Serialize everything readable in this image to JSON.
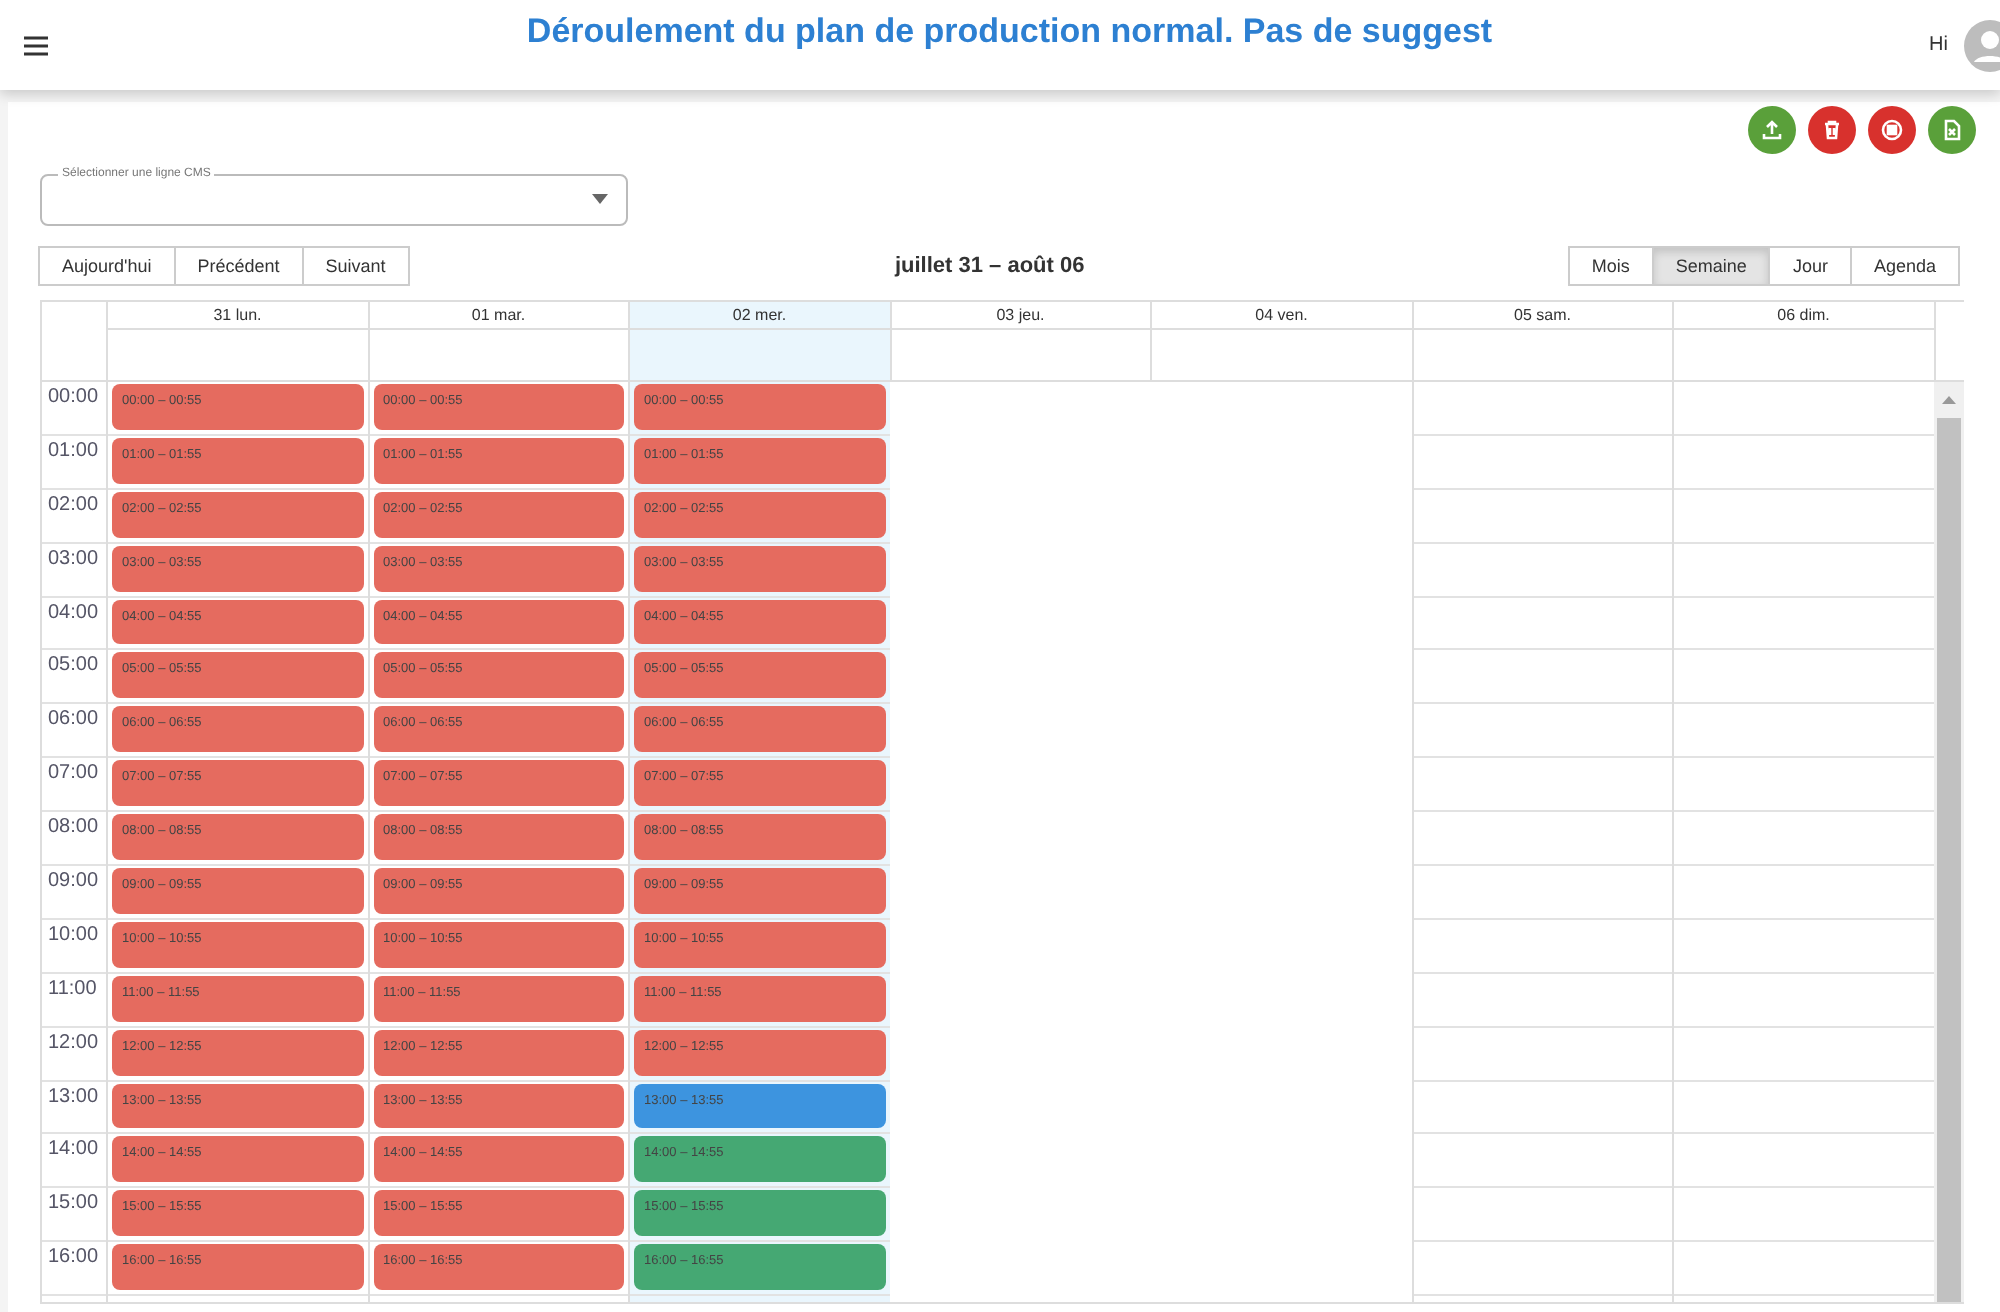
{
  "header": {
    "title": "Déroulement du plan de production normal. Pas de suggest",
    "greeting": "Hi"
  },
  "actions": [
    {
      "kind": "upload",
      "color": "#5aa03a"
    },
    {
      "kind": "delete",
      "color": "#d8312d"
    },
    {
      "kind": "stop",
      "color": "#d8312d"
    },
    {
      "kind": "excel",
      "color": "#5aa03a"
    }
  ],
  "line_select": {
    "label": "Sélectionner une ligne CMS"
  },
  "toolbar": {
    "nav": [
      "Aujourd'hui",
      "Précédent",
      "Suivant"
    ],
    "range": "juillet 31 – août 06",
    "views": [
      {
        "label": "Mois",
        "selected": false
      },
      {
        "label": "Semaine",
        "selected": true
      },
      {
        "label": "Jour",
        "selected": false
      },
      {
        "label": "Agenda",
        "selected": false
      }
    ]
  },
  "hours": [
    "00:00",
    "01:00",
    "02:00",
    "03:00",
    "04:00",
    "05:00",
    "06:00",
    "07:00",
    "08:00",
    "09:00",
    "10:00",
    "11:00",
    "12:00",
    "13:00",
    "14:00",
    "15:00",
    "16:00"
  ],
  "days": [
    {
      "label": "31 lun.",
      "today": false,
      "blank": false,
      "events": [
        {
          "time": "00:00 – 00:55",
          "color": "#e56b5f"
        },
        {
          "time": "01:00 – 01:55",
          "color": "#e56b5f"
        },
        {
          "time": "02:00 – 02:55",
          "color": "#e56b5f"
        },
        {
          "time": "03:00 – 03:55",
          "color": "#e56b5f"
        },
        {
          "time": "04:00 – 04:55",
          "color": "#e56b5f"
        },
        {
          "time": "05:00 – 05:55",
          "color": "#e56b5f"
        },
        {
          "time": "06:00 – 06:55",
          "color": "#e56b5f"
        },
        {
          "time": "07:00 – 07:55",
          "color": "#e56b5f"
        },
        {
          "time": "08:00 – 08:55",
          "color": "#e56b5f"
        },
        {
          "time": "09:00 – 09:55",
          "color": "#e56b5f"
        },
        {
          "time": "10:00 – 10:55",
          "color": "#e56b5f"
        },
        {
          "time": "11:00 – 11:55",
          "color": "#e56b5f"
        },
        {
          "time": "12:00 – 12:55",
          "color": "#e56b5f"
        },
        {
          "time": "13:00 – 13:55",
          "color": "#e56b5f"
        },
        {
          "time": "14:00 – 14:55",
          "color": "#e56b5f"
        },
        {
          "time": "15:00 – 15:55",
          "color": "#e56b5f"
        },
        {
          "time": "16:00 – 16:55",
          "color": "#e56b5f"
        }
      ]
    },
    {
      "label": "01 mar.",
      "today": false,
      "blank": false,
      "events": [
        {
          "time": "00:00 – 00:55",
          "color": "#e56b5f"
        },
        {
          "time": "01:00 – 01:55",
          "color": "#e56b5f"
        },
        {
          "time": "02:00 – 02:55",
          "color": "#e56b5f"
        },
        {
          "time": "03:00 – 03:55",
          "color": "#e56b5f"
        },
        {
          "time": "04:00 – 04:55",
          "color": "#e56b5f"
        },
        {
          "time": "05:00 – 05:55",
          "color": "#e56b5f"
        },
        {
          "time": "06:00 – 06:55",
          "color": "#e56b5f"
        },
        {
          "time": "07:00 – 07:55",
          "color": "#e56b5f"
        },
        {
          "time": "08:00 – 08:55",
          "color": "#e56b5f"
        },
        {
          "time": "09:00 – 09:55",
          "color": "#e56b5f"
        },
        {
          "time": "10:00 – 10:55",
          "color": "#e56b5f"
        },
        {
          "time": "11:00 – 11:55",
          "color": "#e56b5f"
        },
        {
          "time": "12:00 – 12:55",
          "color": "#e56b5f"
        },
        {
          "time": "13:00 – 13:55",
          "color": "#e56b5f"
        },
        {
          "time": "14:00 – 14:55",
          "color": "#e56b5f"
        },
        {
          "time": "15:00 – 15:55",
          "color": "#e56b5f"
        },
        {
          "time": "16:00 – 16:55",
          "color": "#e56b5f"
        }
      ]
    },
    {
      "label": "02 mer.",
      "today": true,
      "blank": false,
      "events": [
        {
          "time": "00:00 – 00:55",
          "color": "#e56b5f"
        },
        {
          "time": "01:00 – 01:55",
          "color": "#e56b5f"
        },
        {
          "time": "02:00 – 02:55",
          "color": "#e56b5f"
        },
        {
          "time": "03:00 – 03:55",
          "color": "#e56b5f"
        },
        {
          "time": "04:00 – 04:55",
          "color": "#e56b5f"
        },
        {
          "time": "05:00 – 05:55",
          "color": "#e56b5f"
        },
        {
          "time": "06:00 – 06:55",
          "color": "#e56b5f"
        },
        {
          "time": "07:00 – 07:55",
          "color": "#e56b5f"
        },
        {
          "time": "08:00 – 08:55",
          "color": "#e56b5f"
        },
        {
          "time": "09:00 – 09:55",
          "color": "#e56b5f"
        },
        {
          "time": "10:00 – 10:55",
          "color": "#e56b5f"
        },
        {
          "time": "11:00 – 11:55",
          "color": "#e56b5f"
        },
        {
          "time": "12:00 – 12:55",
          "color": "#e56b5f"
        },
        {
          "time": "13:00 – 13:55",
          "color": "#3d94df"
        },
        {
          "time": "14:00 – 14:55",
          "color": "#45a873"
        },
        {
          "time": "15:00 – 15:55",
          "color": "#45a873"
        },
        {
          "time": "16:00 – 16:55",
          "color": "#45a873"
        }
      ]
    },
    {
      "label": "03 jeu.",
      "today": false,
      "blank": true
    },
    {
      "label": "04 ven.",
      "today": false,
      "blank": true
    },
    {
      "label": "05 sam.",
      "today": false,
      "blank": false
    },
    {
      "label": "06 dim.",
      "today": false,
      "blank": false
    }
  ]
}
